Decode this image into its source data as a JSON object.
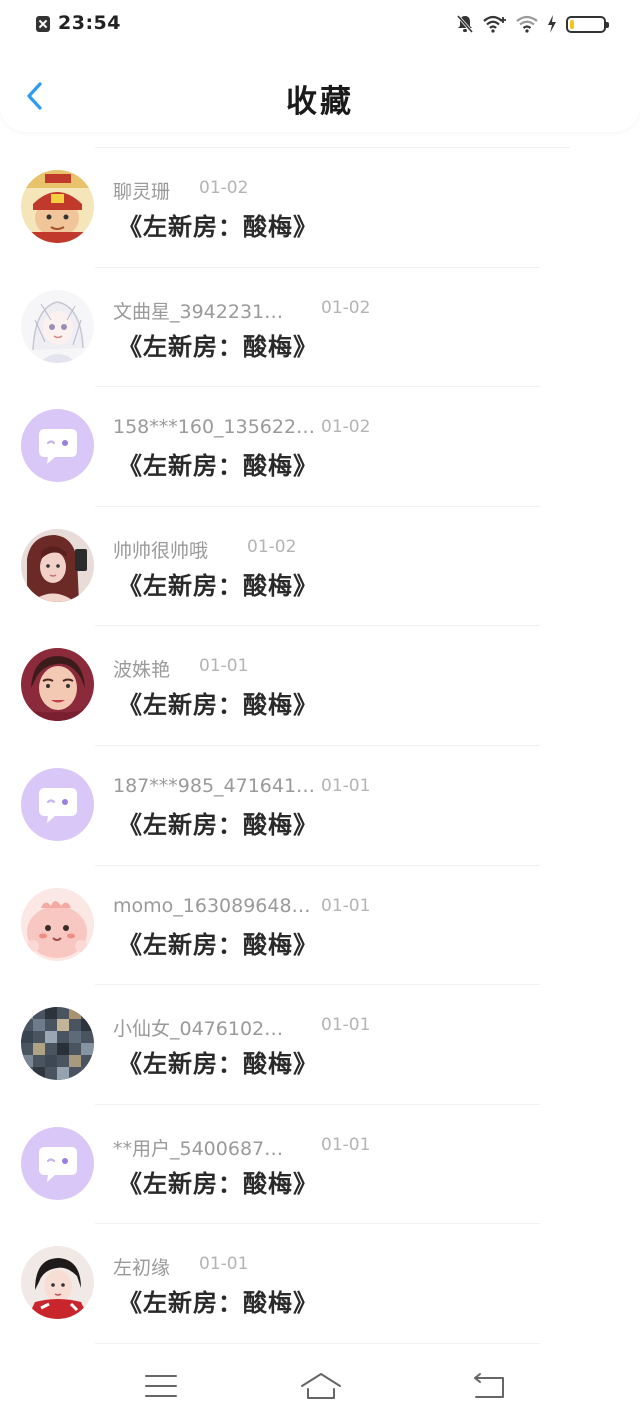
{
  "status_bar": {
    "time": "23:54",
    "battery_level": 0.12,
    "battery_color": "#f5c518"
  },
  "header": {
    "title": "收藏"
  },
  "colors": {
    "accent": "#2d9cf0",
    "username": "#9a9a9a",
    "date": "#b4b4b4",
    "message": "#2a2a2a",
    "default_avatar_bg": "#d9c8f7"
  },
  "items": [
    {
      "username": "聊灵珊",
      "date": "01-02",
      "message": "《左新房：酸梅》",
      "avatar": "taurus-cartoon"
    },
    {
      "username": "文曲星_3942231…",
      "date": "01-02",
      "message": "《左新房：酸梅》",
      "avatar": "anime-sketch"
    },
    {
      "username": "158***160_135622…",
      "date": "01-02",
      "message": "《左新房：酸梅》",
      "avatar": "default-chat-bubble"
    },
    {
      "username": "帅帅很帅哦",
      "date": "01-02",
      "message": "《左新房：酸梅》",
      "avatar": "selfie-girl"
    },
    {
      "username": "波姝艳",
      "date": "01-01",
      "message": "《左新房：酸梅》",
      "avatar": "woman-portrait"
    },
    {
      "username": "187***985_471641…",
      "date": "01-01",
      "message": "《左新房：酸梅》",
      "avatar": "default-chat-bubble"
    },
    {
      "username": "momo_163089648…",
      "date": "01-01",
      "message": "《左新房：酸梅》",
      "avatar": "pink-cartoon"
    },
    {
      "username": "小仙女_0476102…",
      "date": "01-01",
      "message": "《左新房：酸梅》",
      "avatar": "mosaic-pattern"
    },
    {
      "username": "**用户_5400687…",
      "date": "01-01",
      "message": "《左新房：酸梅》",
      "avatar": "default-chat-bubble"
    },
    {
      "username": "左初缘",
      "date": "01-01",
      "message": "《左新房：酸梅》",
      "avatar": "costume-girl"
    }
  ]
}
